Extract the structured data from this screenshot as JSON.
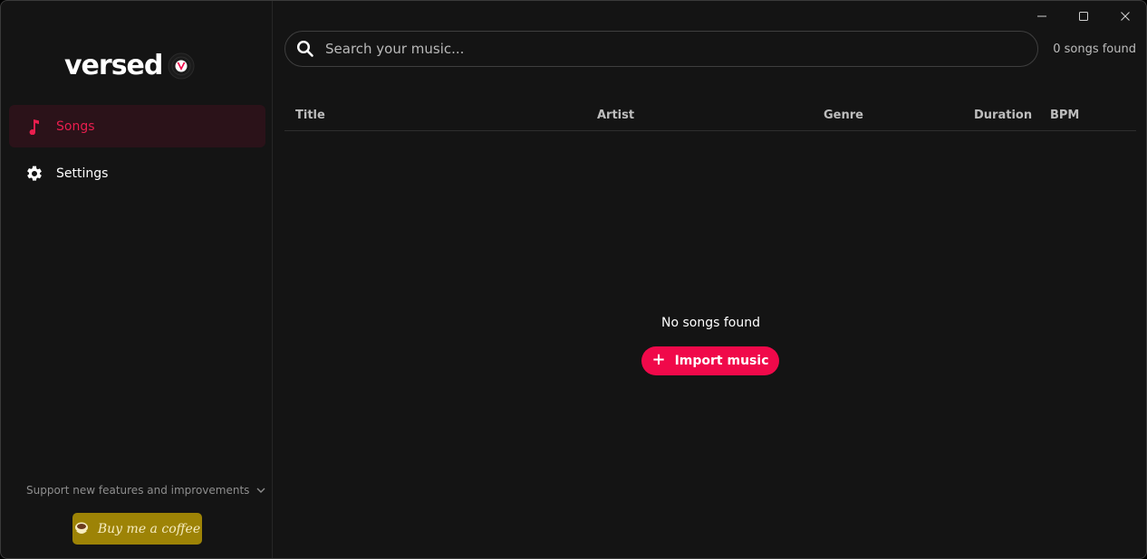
{
  "window": {
    "controls": {
      "minimize_icon": "minimize-icon",
      "maximize_icon": "maximize-icon",
      "close_icon": "close-icon"
    }
  },
  "brand": {
    "name": "versed",
    "logo_icon": "vinyl-disc-icon",
    "accent_color": "#f0094a"
  },
  "sidebar": {
    "items": [
      {
        "label": "Songs",
        "icon": "music-note-icon",
        "active": true
      },
      {
        "label": "Settings",
        "icon": "gear-icon",
        "active": false
      }
    ],
    "support_text": "Support new features and improvements",
    "coffee_label": "Buy me a coffee"
  },
  "search": {
    "placeholder": "Search your music...",
    "value": "",
    "count_text": "0 songs found"
  },
  "table": {
    "columns": [
      "Title",
      "Artist",
      "Genre",
      "Duration",
      "BPM"
    ]
  },
  "empty_state": {
    "message": "No songs found",
    "import_label": "Import music"
  }
}
